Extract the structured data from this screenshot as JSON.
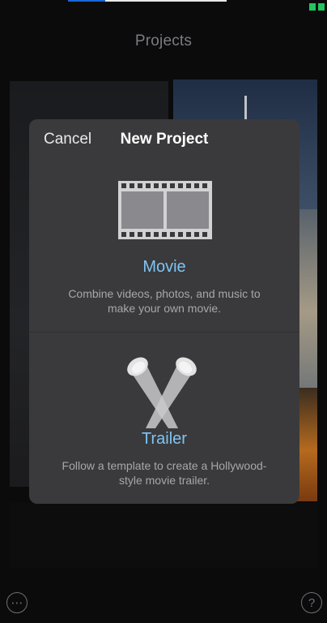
{
  "background": {
    "title": "Projects"
  },
  "modal": {
    "cancel_label": "Cancel",
    "title": "New Project",
    "options": [
      {
        "label": "Movie",
        "description": "Combine videos, photos, and music to make your own movie.",
        "icon": "film-strip-icon"
      },
      {
        "label": "Trailer",
        "description": "Follow a template to create a Hollywood-style movie trailer.",
        "icon": "spotlight-icon"
      }
    ]
  },
  "toolbar": {
    "more_icon": "ellipsis-icon",
    "more_glyph": "⋯",
    "help_icon": "question-icon",
    "help_glyph": "?"
  },
  "colors": {
    "accent": "#7fc4f2",
    "modal_bg": "#3a3a3c",
    "battery": "#22c55e"
  }
}
